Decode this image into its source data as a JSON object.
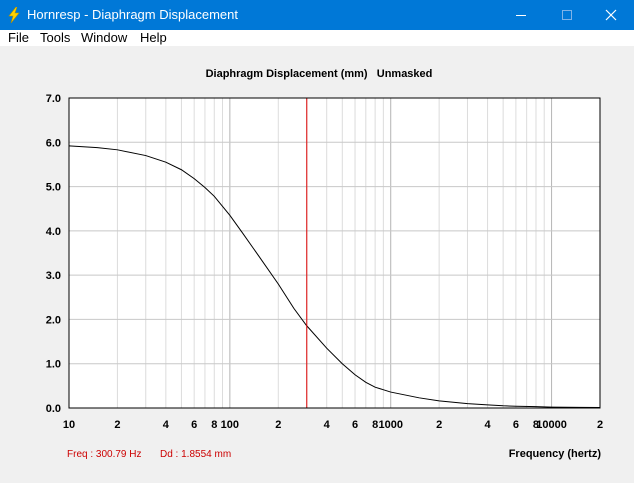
{
  "window": {
    "title": "Hornresp - Diaphragm Displacement",
    "icon": "lightning-bolt-icon",
    "controls": [
      "minimize-icon",
      "maximize-icon",
      "close-icon"
    ]
  },
  "menu": [
    "File",
    "Tools",
    "Window",
    "Help"
  ],
  "chart_title": "Diaphragm Displacement (mm)   Unmasked",
  "readout": {
    "freq": "Freq : 300.79 Hz",
    "dd": "Dd : 1.8554 mm"
  },
  "xlabel": "Frequency (hertz)",
  "colors": {
    "titlebar": "#0078d7",
    "cursor": "#e00000",
    "readout": "#cc0000",
    "grid": "#c8c8c8"
  },
  "chart_data": {
    "type": "line",
    "x_scale": "log",
    "xlim": [
      10,
      20000
    ],
    "ylim": [
      0,
      7
    ],
    "y_ticks": [
      "0.0",
      "1.0",
      "2.0",
      "3.0",
      "4.0",
      "5.0",
      "6.0",
      "7.0"
    ],
    "x_ticks": [
      "10",
      "2",
      "4",
      "6",
      "8",
      "100",
      "2",
      "4",
      "6",
      "8",
      "1000",
      "2",
      "4",
      "6",
      "8",
      "10000",
      "2"
    ],
    "cursor_x": 300.79,
    "series": [
      {
        "x": [
          10,
          15,
          20,
          30,
          40,
          50,
          60,
          70,
          80,
          100,
          120,
          150,
          200,
          250,
          300,
          400,
          500,
          600,
          700,
          800,
          1000,
          1500,
          2000,
          3000,
          4000,
          5000,
          6000,
          8000,
          10000,
          15000,
          20000
        ],
        "y": [
          5.92,
          5.88,
          5.83,
          5.7,
          5.55,
          5.38,
          5.18,
          4.98,
          4.78,
          4.35,
          3.95,
          3.45,
          2.8,
          2.25,
          1.86,
          1.35,
          1.0,
          0.75,
          0.58,
          0.47,
          0.36,
          0.23,
          0.16,
          0.1,
          0.07,
          0.05,
          0.04,
          0.03,
          0.02,
          0.015,
          0.01
        ]
      }
    ]
  }
}
